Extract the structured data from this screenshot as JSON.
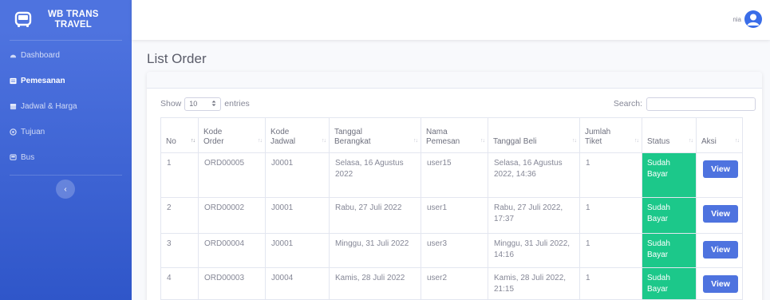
{
  "brand": {
    "line1": "WB TRANS",
    "line2": "TRAVEL"
  },
  "sidebar": {
    "items": [
      {
        "label": "Dashboard",
        "icon": "dashboard-icon",
        "active": false
      },
      {
        "label": "Pemesanan",
        "icon": "pemesanan-icon",
        "active": true
      },
      {
        "label": "Jadwal & Harga",
        "icon": "calendar-icon",
        "active": false
      },
      {
        "label": "Tujuan",
        "icon": "target-icon",
        "active": false
      },
      {
        "label": "Bus",
        "icon": "bus-icon",
        "active": false
      }
    ],
    "toggle": "‹"
  },
  "topbar": {
    "user_name": "nia"
  },
  "page": {
    "title": "List Order"
  },
  "table_controls": {
    "show_label": "Show",
    "entries_value": "10",
    "entries_label": "entries",
    "search_label": "Search:"
  },
  "table": {
    "headers": [
      "No",
      "Kode\nOrder",
      "Kode\nJadwal",
      "Tanggal\nBerangkat",
      "Nama\nPemesan",
      "Tanggal Beli",
      "Jumlah\nTiket",
      "Status",
      "Aksi"
    ],
    "rows": [
      {
        "no": "1",
        "kode_order": "ORD00005",
        "kode_jadwal": "J0001",
        "tanggal_berangkat": "Selasa, 16 Agustus 2022",
        "nama_pemesan": "user15",
        "tanggal_beli": "Selasa, 16 Agustus 2022, 14:36",
        "jumlah_tiket": "1",
        "status": "Sudah Bayar",
        "aksi": "View"
      },
      {
        "no": "2",
        "kode_order": "ORD00002",
        "kode_jadwal": "J0001",
        "tanggal_berangkat": "Rabu, 27 Juli 2022",
        "nama_pemesan": "user1",
        "tanggal_beli": "Rabu, 27 Juli 2022, 17:37",
        "jumlah_tiket": "1",
        "status": "Sudah Bayar",
        "aksi": "View"
      },
      {
        "no": "3",
        "kode_order": "ORD00004",
        "kode_jadwal": "J0001",
        "tanggal_berangkat": "Minggu, 31 Juli 2022",
        "nama_pemesan": "user3",
        "tanggal_beli": "Minggu, 31 Juli 2022, 14:16",
        "jumlah_tiket": "1",
        "status": "Sudah Bayar",
        "aksi": "View"
      },
      {
        "no": "4",
        "kode_order": "ORD00003",
        "kode_jadwal": "J0004",
        "tanggal_berangkat": "Kamis, 28 Juli 2022",
        "nama_pemesan": "user2",
        "tanggal_beli": "Kamis, 28 Juli 2022, 21:15",
        "jumlah_tiket": "1",
        "status": "Sudah Bayar",
        "aksi": "View"
      }
    ]
  },
  "colors": {
    "sidebar": "#4e73df",
    "status_paid": "#1cc88a",
    "button": "#4e73df"
  }
}
